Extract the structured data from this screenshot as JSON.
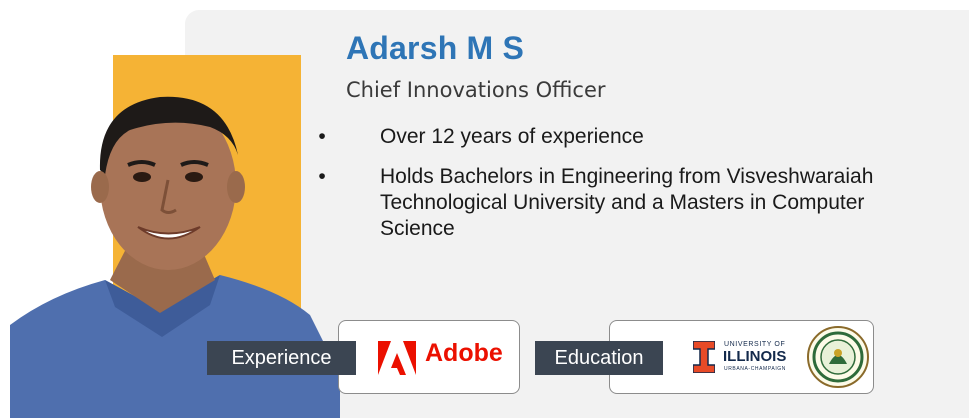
{
  "profile": {
    "name": "Adarsh M S",
    "role": "Chief Innovations Officer",
    "bullets": [
      "Over 12 years of experience",
      "Holds Bachelors in Engineering from Visveshwaraiah Technological University and a Masters in Computer Science"
    ]
  },
  "experience": {
    "label": "Experience",
    "company": "Adobe"
  },
  "education": {
    "label": "Education",
    "university_top": "UNIVERSITY OF",
    "university_name": "ILLINOIS",
    "university_sub": "URBANA-CHAMPAIGN"
  },
  "colors": {
    "name_blue": "#2e75b6",
    "accent_orange": "#f5b335",
    "label_bg": "#3b4552",
    "adobe_red": "#eb1000",
    "illini_orange": "#e84a27",
    "illini_navy": "#13294b"
  }
}
